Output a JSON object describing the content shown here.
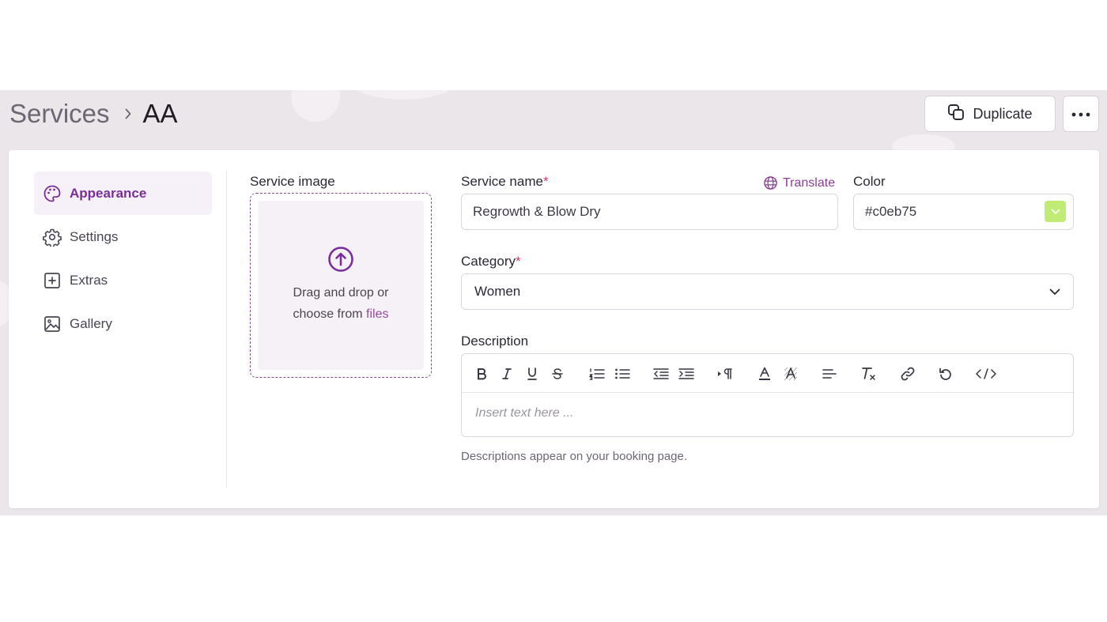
{
  "breadcrumb": {
    "root": "Services",
    "current": "AA"
  },
  "header": {
    "duplicate_label": "Duplicate"
  },
  "sidebar": {
    "items": [
      {
        "label": "Appearance",
        "icon": "palette-icon",
        "active": true
      },
      {
        "label": "Settings",
        "icon": "gear-icon",
        "active": false
      },
      {
        "label": "Extras",
        "icon": "plus-square-icon",
        "active": false
      },
      {
        "label": "Gallery",
        "icon": "image-icon",
        "active": false
      }
    ]
  },
  "image": {
    "label": "Service image",
    "drop_text": "Drag and drop or choose from",
    "drop_link": "files"
  },
  "service_name": {
    "label": "Service name",
    "required_mark": "*",
    "value": "Regrowth & Blow Dry",
    "translate_label": "Translate"
  },
  "color": {
    "label": "Color",
    "value": "#c0eb75",
    "swatch": "#c0eb75"
  },
  "category": {
    "label": "Category",
    "required_mark": "*",
    "value": "Women"
  },
  "description": {
    "label": "Description",
    "placeholder": "Insert text here ...",
    "hint": "Descriptions appear on your booking page.",
    "toolbar": [
      "bold",
      "italic",
      "underline",
      "strikethrough",
      "ordered-list",
      "bullet-list",
      "outdent",
      "indent",
      "text-direction",
      "font-color",
      "highlight",
      "align",
      "clear-format",
      "link",
      "undo",
      "code-view"
    ]
  },
  "colors": {
    "accent": "#7b2d9c",
    "required": "#d63a6b"
  }
}
